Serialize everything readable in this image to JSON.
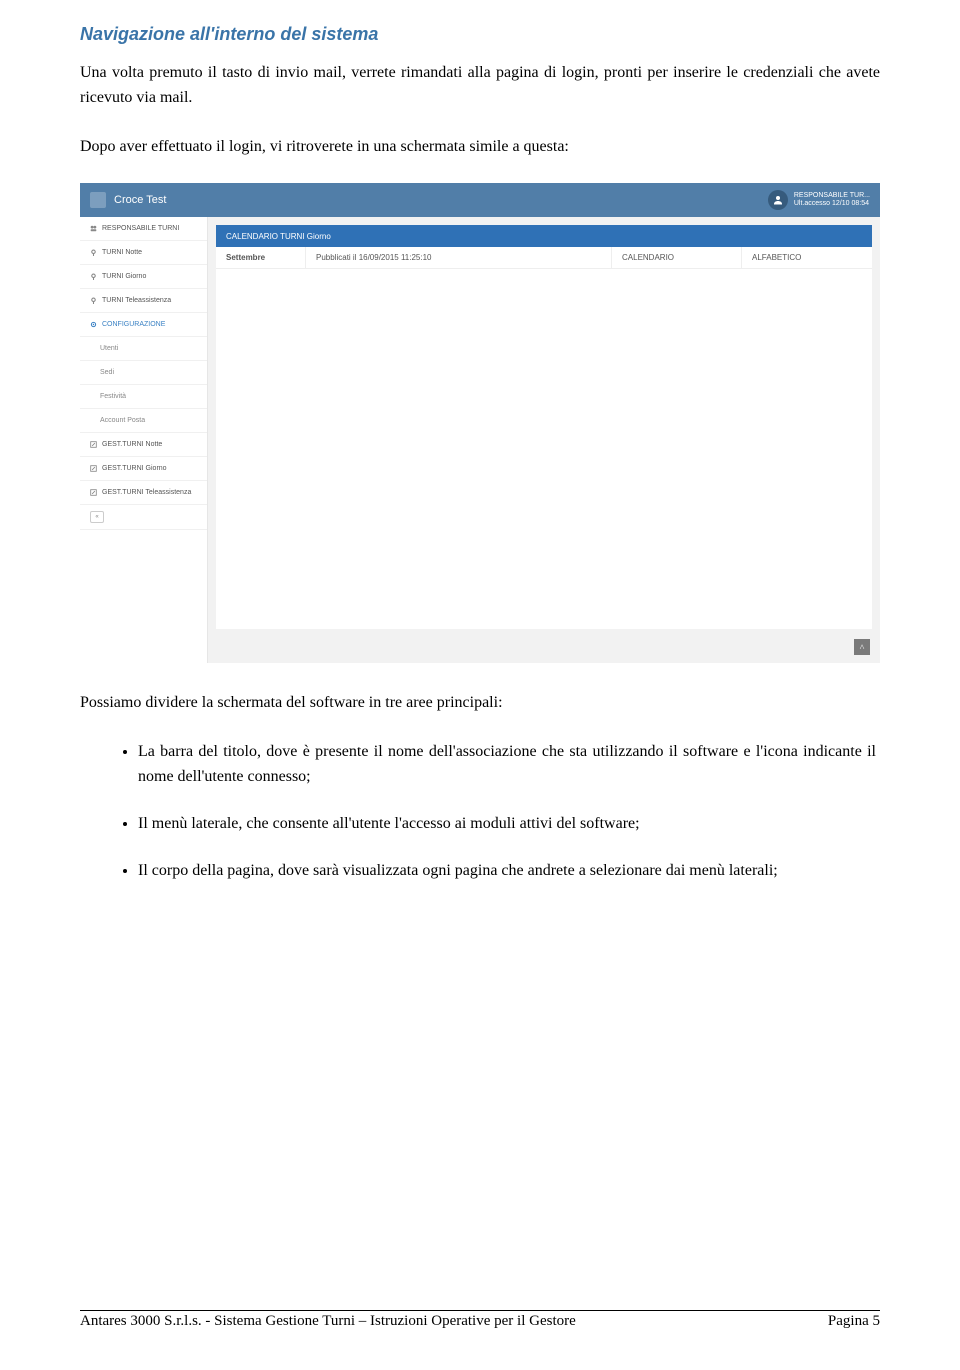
{
  "heading": "Navigazione all'interno del sistema",
  "para1": "Una volta premuto il tasto di invio mail, verrete rimandati alla pagina di login, pronti per inserire le credenziali che avete ricevuto via mail.",
  "para2": "Dopo aver effettuato il login, vi ritroverete in una schermata simile a questa:",
  "para3": "Possiamo dividere la schermata del software in tre aree principali:",
  "bullets": [
    "La barra del titolo, dove è presente il nome dell'associazione che sta utilizzando il software e l'icona indicante il nome dell'utente connesso;",
    "Il menù laterale, che consente all'utente l'accesso ai moduli attivi del software;",
    "Il corpo della pagina, dove sarà visualizzata ogni pagina che andrete a selezionare dai menù laterali;"
  ],
  "screenshot": {
    "app_title": "Croce Test",
    "user_line1": "RESPONSABILE TUR...",
    "user_line2": "Ult.accesso 12/10 08:54",
    "sidebar": [
      "RESPONSABILE TURNI",
      "TURNI Notte",
      "TURNI Giorno",
      "TURNI Teleassistenza",
      "CONFIGURAZIONE",
      "Utenti",
      "Sedi",
      "Festività",
      "Account Posta",
      "GEST.TURNI Notte",
      "GEST.TURNI Giorno",
      "GEST.TURNI Teleassistenza"
    ],
    "panel_header": "CALENDARIO TURNI Giorno",
    "row_month": "Settembre",
    "row_published": "Pubblicati il 16/09/2015 11:25:10",
    "row_cal": "CALENDARIO",
    "row_alpha": "ALFABETICO"
  },
  "footer_left": "Antares 3000 S.r.l.s. - Sistema Gestione Turni – Istruzioni Operative per il Gestore",
  "footer_right": "Pagina 5"
}
